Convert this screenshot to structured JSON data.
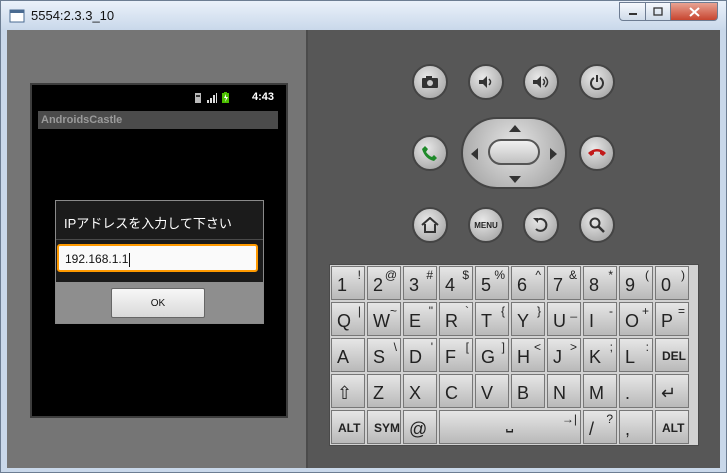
{
  "window": {
    "title": "5554:2.3.3_10"
  },
  "device": {
    "status_time": "4:43",
    "app_title": "AndroidsCastle",
    "dialog": {
      "title": "IPアドレスを入力して下さい",
      "input_value": "192.168.1.1",
      "ok_label": "OK"
    }
  },
  "controls": {
    "menu_label": "MENU"
  },
  "keyboard": {
    "rows": [
      [
        {
          "m": "1",
          "s": "!"
        },
        {
          "m": "2",
          "s": "@"
        },
        {
          "m": "3",
          "s": "#"
        },
        {
          "m": "4",
          "s": "$"
        },
        {
          "m": "5",
          "s": "%"
        },
        {
          "m": "6",
          "s": "^"
        },
        {
          "m": "7",
          "s": "&"
        },
        {
          "m": "8",
          "s": "*"
        },
        {
          "m": "9",
          "s": "("
        },
        {
          "m": "0",
          "s": ")"
        }
      ],
      [
        {
          "m": "Q",
          "s": "|"
        },
        {
          "m": "W",
          "s": "~"
        },
        {
          "m": "E",
          "s": "\""
        },
        {
          "m": "R",
          "s": "`"
        },
        {
          "m": "T",
          "s": "{"
        },
        {
          "m": "Y",
          "s": "}"
        },
        {
          "m": "U",
          "s": "_"
        },
        {
          "m": "I",
          "s": "-"
        },
        {
          "m": "O",
          "s": "+"
        },
        {
          "m": "P",
          "s": "="
        }
      ],
      [
        {
          "m": "A",
          "s": ""
        },
        {
          "m": "S",
          "s": "\\"
        },
        {
          "m": "D",
          "s": "'"
        },
        {
          "m": "F",
          "s": "["
        },
        {
          "m": "G",
          "s": "]"
        },
        {
          "m": "H",
          "s": "<"
        },
        {
          "m": "J",
          "s": ">"
        },
        {
          "m": "K",
          "s": ";"
        },
        {
          "m": "L",
          "s": ":"
        },
        {
          "m": "DEL",
          "s": ""
        }
      ],
      [
        {
          "m": "⇧",
          "s": ""
        },
        {
          "m": "Z",
          "s": ""
        },
        {
          "m": "X",
          "s": ""
        },
        {
          "m": "C",
          "s": ""
        },
        {
          "m": "V",
          "s": ""
        },
        {
          "m": "B",
          "s": ""
        },
        {
          "m": "N",
          "s": ""
        },
        {
          "m": "M",
          "s": ""
        },
        {
          "m": ".",
          "s": ""
        },
        {
          "m": "↵",
          "s": ""
        }
      ],
      [
        {
          "m": "ALT",
          "s": ""
        },
        {
          "m": "SYM",
          "s": ""
        },
        {
          "m": "@",
          "s": ""
        },
        {
          "m": "⎵",
          "s": "→|"
        },
        {
          "m": "/",
          "s": "?"
        },
        {
          "m": ",",
          "s": ""
        },
        {
          "m": "ALT",
          "s": ""
        }
      ]
    ]
  },
  "colors": {
    "input_focus": "#ff9a00",
    "call_green": "#1f8a2a",
    "end_red": "#c21a1a"
  }
}
